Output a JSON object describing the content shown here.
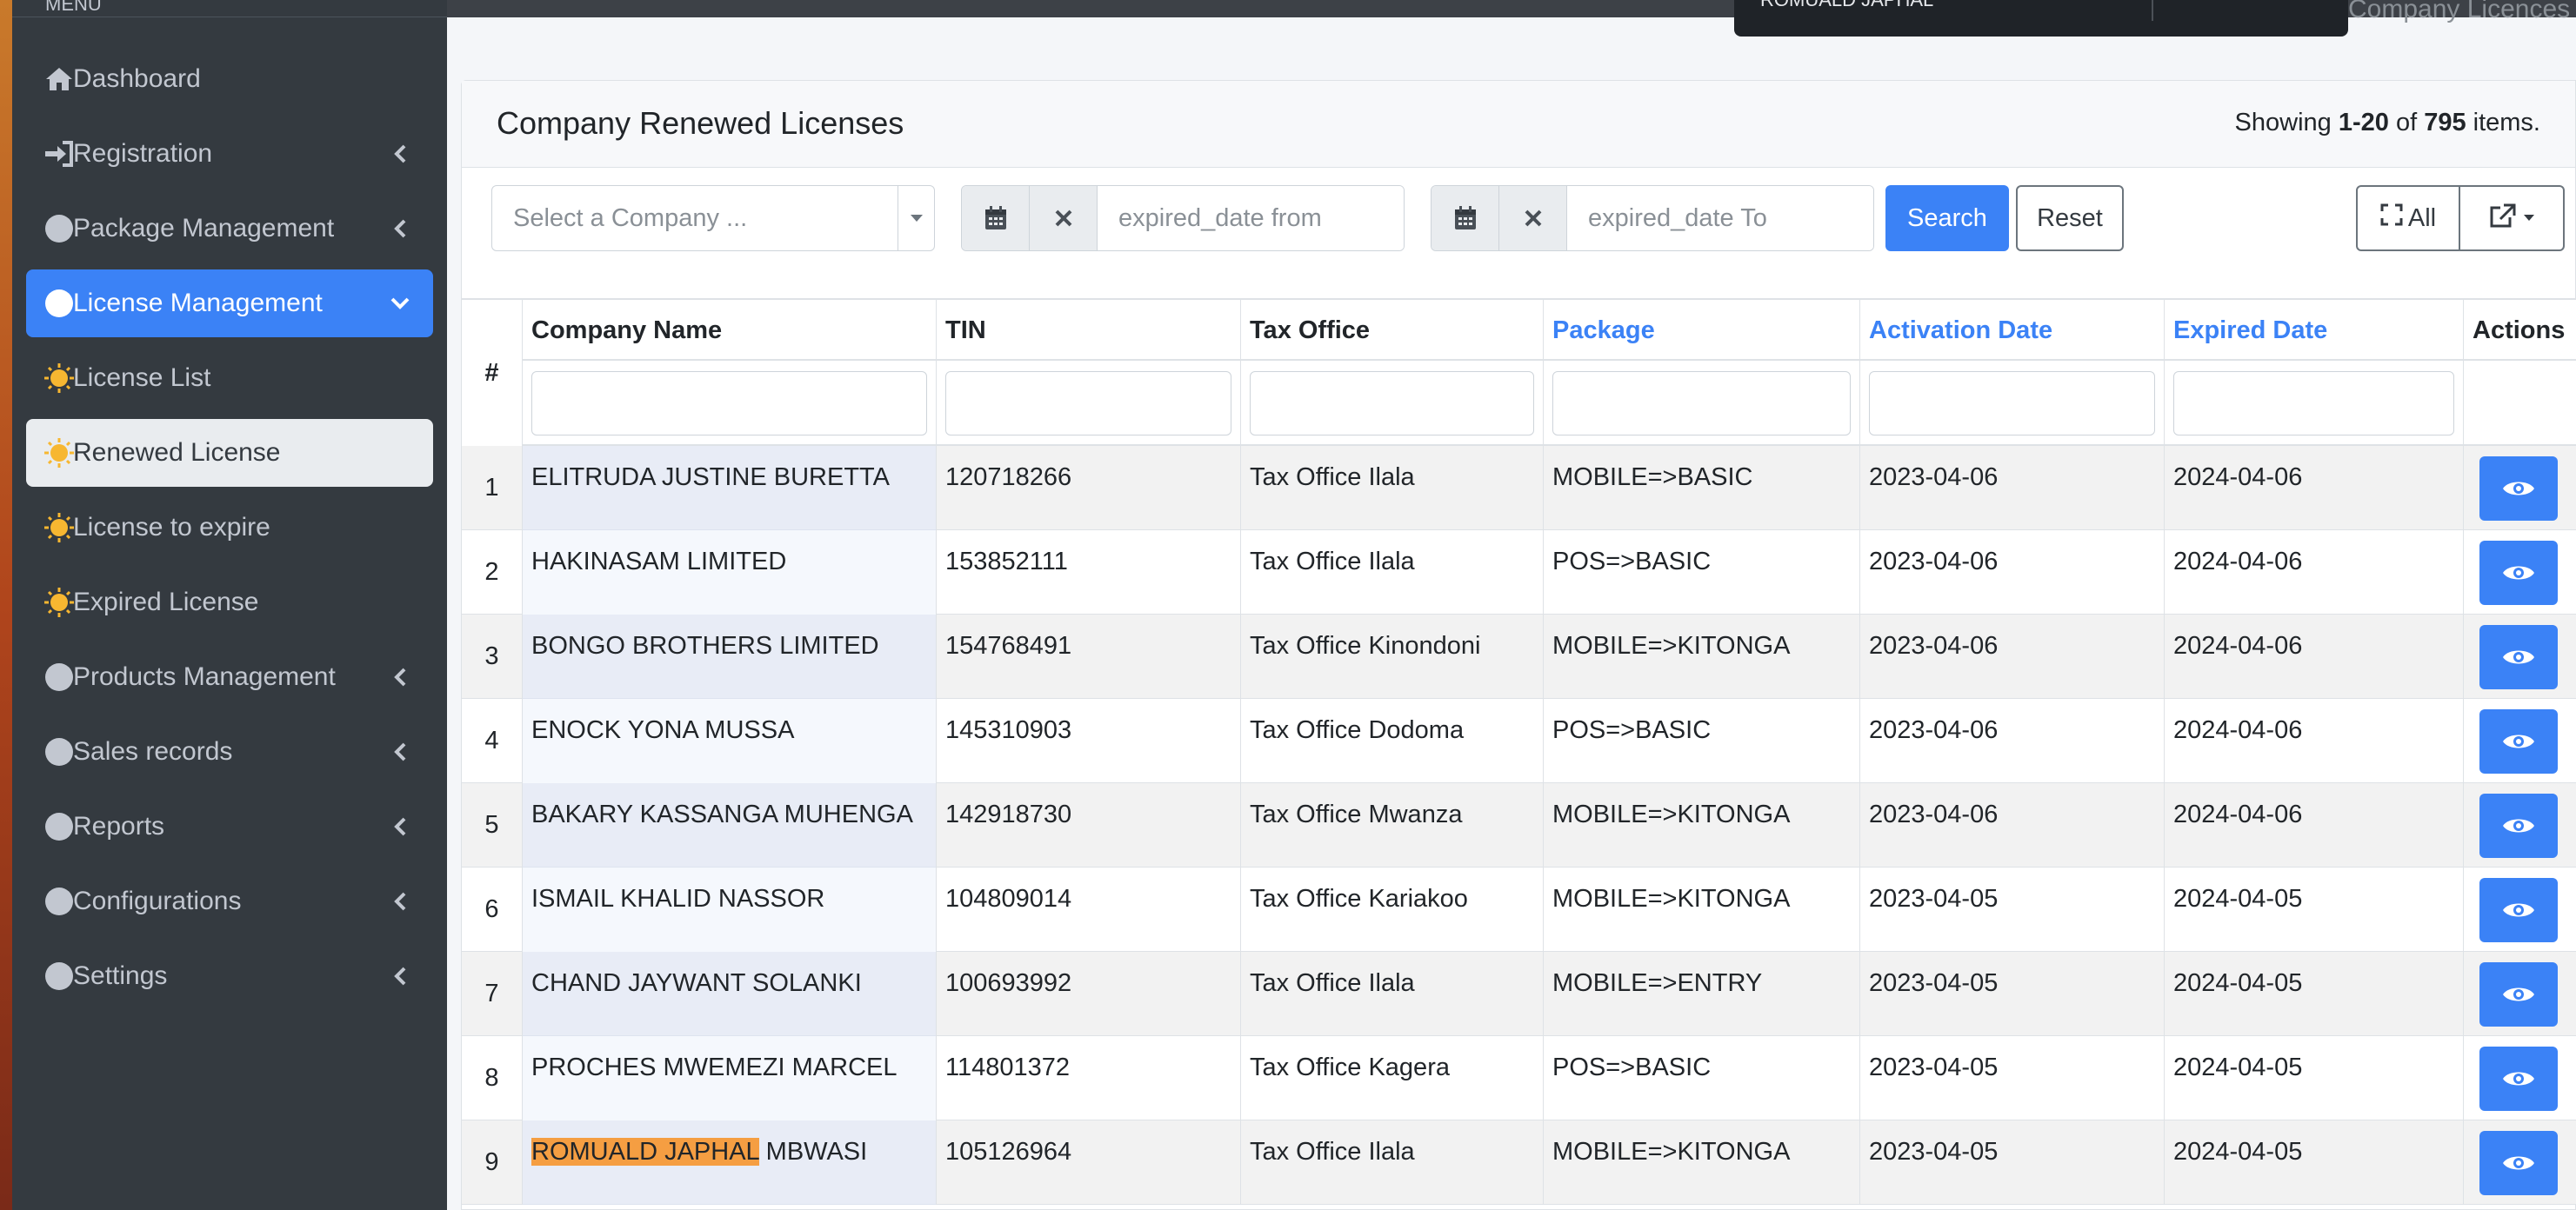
{
  "sidebar": {
    "header": "MENU",
    "items": [
      {
        "label": "Dashboard",
        "icon": "home-icon"
      },
      {
        "label": "Registration",
        "icon": "sign-in-icon"
      },
      {
        "label": "Package Management",
        "icon": "circle-icon"
      },
      {
        "label": "License Management",
        "icon": "circle-icon"
      },
      {
        "label": "License List",
        "icon": "sun-icon"
      },
      {
        "label": "Renewed License",
        "icon": "sun-icon"
      },
      {
        "label": "License to expire",
        "icon": "sun-icon"
      },
      {
        "label": "Expired License",
        "icon": "sun-icon"
      },
      {
        "label": "Products Management",
        "icon": "circle-icon"
      },
      {
        "label": "Sales records",
        "icon": "circle-icon"
      },
      {
        "label": "Reports",
        "icon": "circle-icon"
      },
      {
        "label": "Configurations",
        "icon": "circle-icon"
      },
      {
        "label": "Settings",
        "icon": "circle-icon"
      }
    ]
  },
  "tooltip": {
    "text": "ROMUALD JAPHAL"
  },
  "breadcrumb": {
    "current": "Company Licences"
  },
  "card": {
    "title": "Company Renewed Licenses",
    "summary_prefix": "Showing ",
    "summary_range": "1-20",
    "summary_of": " of ",
    "summary_total": "795",
    "summary_suffix": " items."
  },
  "toolbar": {
    "company_placeholder": "Select a Company ...",
    "from_placeholder": "expired_date from",
    "to_placeholder": "expired_date To",
    "search_label": "Search",
    "reset_label": "Reset",
    "all_label": "All"
  },
  "table": {
    "hash_header": "#",
    "columns": [
      "Company Name",
      "TIN",
      "Tax Office",
      "Package",
      "Activation Date",
      "Expired Date",
      "Actions"
    ],
    "rows": [
      {
        "n": "1",
        "company": "ELITRUDA JUSTINE BURETTA",
        "tin": "120718266",
        "office": "Tax Office Ilala",
        "package": "MOBILE=>BASIC",
        "activation": "2023-04-06",
        "expired": "2024-04-06"
      },
      {
        "n": "2",
        "company": "HAKINASAM LIMITED",
        "tin": "153852111",
        "office": "Tax Office Ilala",
        "package": "POS=>BASIC",
        "activation": "2023-04-06",
        "expired": "2024-04-06"
      },
      {
        "n": "3",
        "company": "BONGO BROTHERS LIMITED",
        "tin": "154768491",
        "office": "Tax Office Kinondoni",
        "package": "MOBILE=>KITONGA",
        "activation": "2023-04-06",
        "expired": "2024-04-06"
      },
      {
        "n": "4",
        "company": "ENOCK YONA MUSSA",
        "tin": "145310903",
        "office": "Tax Office Dodoma",
        "package": "POS=>BASIC",
        "activation": "2023-04-06",
        "expired": "2024-04-06"
      },
      {
        "n": "5",
        "company": "BAKARY KASSANGA MUHENGA",
        "tin": "142918730",
        "office": "Tax Office Mwanza",
        "package": "MOBILE=>KITONGA",
        "activation": "2023-04-06",
        "expired": "2024-04-06"
      },
      {
        "n": "6",
        "company": "ISMAIL KHALID NASSOR",
        "tin": "104809014",
        "office": "Tax Office Kariakoo",
        "package": "MOBILE=>KITONGA",
        "activation": "2023-04-05",
        "expired": "2024-04-05"
      },
      {
        "n": "7",
        "company": "CHAND JAYWANT SOLANKI",
        "tin": "100693992",
        "office": "Tax Office Ilala",
        "package": "MOBILE=>ENTRY",
        "activation": "2023-04-05",
        "expired": "2024-04-05"
      },
      {
        "n": "8",
        "company": "PROCHES MWEMEZI MARCEL",
        "tin": "114801372",
        "office": "Tax Office Kagera",
        "package": "POS=>BASIC",
        "activation": "2023-04-05",
        "expired": "2024-04-05"
      },
      {
        "n": "9",
        "company_highlight": "ROMUALD JAPHAL",
        "company_rest": " MBWASI",
        "tin": "105126964",
        "office": "Tax Office Ilala",
        "package": "MOBILE=>KITONGA",
        "activation": "2023-04-05",
        "expired": "2024-04-05"
      }
    ]
  },
  "colors": {
    "accent": "#3b82f6",
    "sidebar": "#343a40",
    "highlight": "#f59e42"
  }
}
